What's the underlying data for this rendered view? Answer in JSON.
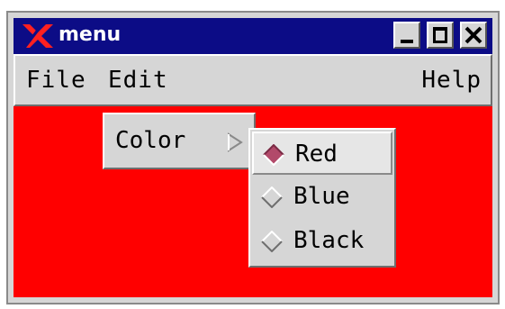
{
  "window": {
    "title": "menu",
    "logo_icon": "x-logo-icon",
    "titlebar_color": "#0c0c86",
    "client_color": "#ff0000"
  },
  "titlebar_buttons": {
    "minimize_icon": "minimize-icon",
    "maximize_icon": "maximize-icon",
    "close_icon": "close-icon"
  },
  "menubar": {
    "file": "File",
    "edit": "Edit",
    "help": "Help"
  },
  "edit_menu": {
    "color_label": "Color",
    "cascade_icon": "cascade-arrow-icon"
  },
  "color_submenu": {
    "selected": "Red",
    "items": [
      {
        "label": "Red",
        "selected": true
      },
      {
        "label": "Blue",
        "selected": false
      },
      {
        "label": "Black",
        "selected": false
      }
    ],
    "selected_color": "#b24a6a"
  }
}
